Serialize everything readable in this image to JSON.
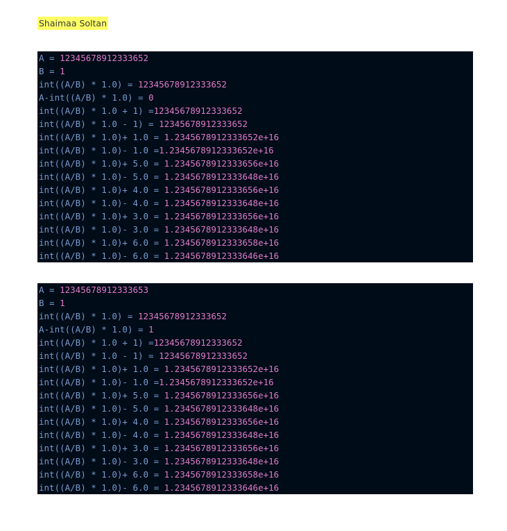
{
  "document": {
    "author": "Shaimaa Soltan"
  },
  "outputs": [
    {
      "lines": [
        {
          "expr": "A = ",
          "val": "12345678912333652"
        },
        {
          "expr": "B = ",
          "val": "1"
        },
        {
          "expr": "int((A/B) * 1.0) = ",
          "val": "12345678912333652"
        },
        {
          "expr": "A-int((A/B) * 1.0) = ",
          "val": "0"
        },
        {
          "expr": "int((A/B) * 1.0 + 1) =",
          "val": "12345678912333652"
        },
        {
          "expr": "int((A/B) * 1.0 - 1) = ",
          "val": "12345678912333652"
        },
        {
          "expr": "int((A/B) * 1.0)+ 1.0 = ",
          "val": "1.2345678912333652e+16"
        },
        {
          "expr": "int((A/B) * 1.0)- 1.0 =",
          "val": "1.2345678912333652e+16"
        },
        {
          "expr": "int((A/B) * 1.0)+ 5.0 = ",
          "val": "1.2345678912333656e+16"
        },
        {
          "expr": "int((A/B) * 1.0)- 5.0 = ",
          "val": "1.2345678912333648e+16"
        },
        {
          "expr": "int((A/B) * 1.0)+ 4.0 = ",
          "val": "1.2345678912333656e+16"
        },
        {
          "expr": "int((A/B) * 1.0)- 4.0 = ",
          "val": "1.2345678912333648e+16"
        },
        {
          "expr": "int((A/B) * 1.0)+ 3.0 = ",
          "val": "1.2345678912333656e+16"
        },
        {
          "expr": "int((A/B) * 1.0)- 3.0 = ",
          "val": "1.2345678912333648e+16"
        },
        {
          "expr": "int((A/B) * 1.0)+ 6.0 = ",
          "val": "1.2345678912333658e+16"
        },
        {
          "expr": "int((A/B) * 1.0)- 6.0 = ",
          "val": "1.2345678912333646e+16"
        }
      ]
    },
    {
      "lines": [
        {
          "expr": "A = ",
          "val": "12345678912333653"
        },
        {
          "expr": "B = ",
          "val": "1"
        },
        {
          "expr": "int((A/B) * 1.0) = ",
          "val": "12345678912333652"
        },
        {
          "expr": "A-int((A/B) * 1.0) = ",
          "val": "1"
        },
        {
          "expr": "int((A/B) * 1.0 + 1) =",
          "val": "12345678912333652"
        },
        {
          "expr": "int((A/B) * 1.0 - 1) = ",
          "val": "12345678912333652"
        },
        {
          "expr": "int((A/B) * 1.0)+ 1.0 = ",
          "val": "1.2345678912333652e+16"
        },
        {
          "expr": "int((A/B) * 1.0)- 1.0 =",
          "val": "1.2345678912333652e+16"
        },
        {
          "expr": "int((A/B) * 1.0)+ 5.0 = ",
          "val": "1.2345678912333656e+16"
        },
        {
          "expr": "int((A/B) * 1.0)- 5.0 = ",
          "val": "1.2345678912333648e+16"
        },
        {
          "expr": "int((A/B) * 1.0)+ 4.0 = ",
          "val": "1.2345678912333656e+16"
        },
        {
          "expr": "int((A/B) * 1.0)- 4.0 = ",
          "val": "1.2345678912333648e+16"
        },
        {
          "expr": "int((A/B) * 1.0)+ 3.0 = ",
          "val": "1.2345678912333656e+16"
        },
        {
          "expr": "int((A/B) * 1.0)- 3.0 = ",
          "val": "1.2345678912333648e+16"
        },
        {
          "expr": "int((A/B) * 1.0)+ 6.0 = ",
          "val": "1.2345678912333658e+16"
        },
        {
          "expr": "int((A/B) * 1.0)- 6.0 = ",
          "val": "1.2345678912333646e+16"
        }
      ]
    }
  ],
  "colors": {
    "page_background": "#ffffff",
    "highlight": "#ffff66",
    "code_background": "#000c18",
    "expression_text": "#7a9bcf",
    "value_text": "#e07ac8"
  }
}
